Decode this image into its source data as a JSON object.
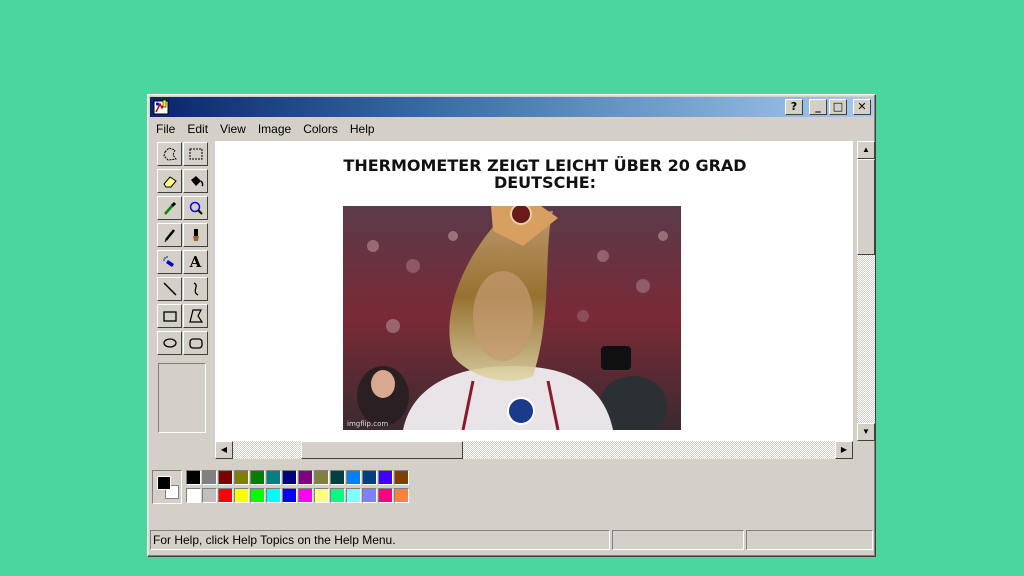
{
  "window": {
    "controls": {
      "help": "?",
      "minimize": "_",
      "maximize": "□",
      "close": "✕"
    }
  },
  "menu": [
    "File",
    "Edit",
    "View",
    "Image",
    "Colors",
    "Help"
  ],
  "tools": [
    {
      "name": "free-select-icon"
    },
    {
      "name": "select-icon"
    },
    {
      "name": "eraser-icon"
    },
    {
      "name": "fill-icon"
    },
    {
      "name": "pick-color-icon"
    },
    {
      "name": "magnifier-icon"
    },
    {
      "name": "pencil-icon"
    },
    {
      "name": "brush-icon"
    },
    {
      "name": "airbrush-icon"
    },
    {
      "name": "text-icon"
    },
    {
      "name": "line-icon"
    },
    {
      "name": "curve-icon"
    },
    {
      "name": "rectangle-icon"
    },
    {
      "name": "polygon-icon"
    },
    {
      "name": "ellipse-icon"
    },
    {
      "name": "rounded-rectangle-icon"
    }
  ],
  "tool_text_glyph": "A",
  "canvas": {
    "meme_line1": "THERMOMETER ZEIGT LEICHT ÜBER 20 GRAD",
    "meme_line2": "DEUTSCHE:",
    "watermark": "imgflip.com"
  },
  "colors": {
    "foreground": "#000000",
    "background": "#ffffff",
    "row1": [
      "#000000",
      "#808080",
      "#800000",
      "#808000",
      "#008000",
      "#008080",
      "#000080",
      "#800080",
      "#808040",
      "#004040",
      "#0080ff",
      "#004080",
      "#4000ff",
      "#804000"
    ],
    "row2": [
      "#ffffff",
      "#c0c0c0",
      "#ff0000",
      "#ffff00",
      "#00ff00",
      "#00ffff",
      "#0000ff",
      "#ff00ff",
      "#ffff80",
      "#00ff80",
      "#80ffff",
      "#8080ff",
      "#ff0080",
      "#ff8040"
    ]
  },
  "status": {
    "help_text": "For Help, click Help Topics on the Help Menu."
  }
}
